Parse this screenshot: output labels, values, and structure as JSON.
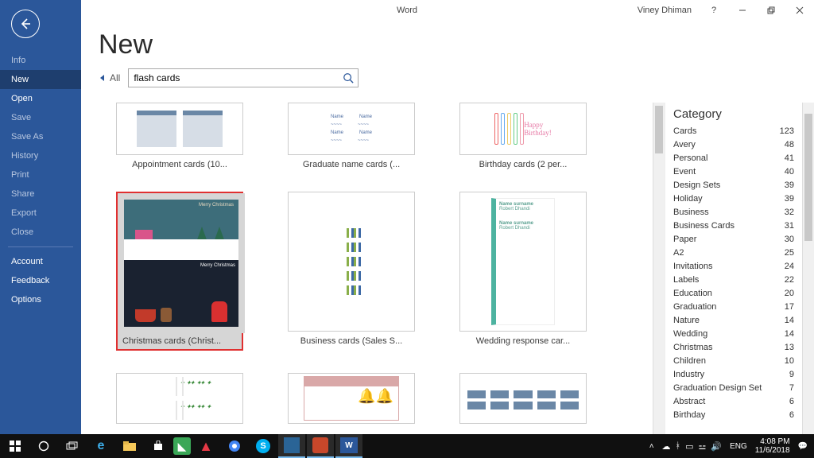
{
  "titlebar": {
    "app": "Word",
    "user": "Viney Dhiman"
  },
  "sidebar": {
    "items": [
      {
        "label": "Info",
        "enabled": false
      },
      {
        "label": "New",
        "enabled": true,
        "selected": true
      },
      {
        "label": "Open",
        "enabled": true
      },
      {
        "label": "Save",
        "enabled": false
      },
      {
        "label": "Save As",
        "enabled": false
      },
      {
        "label": "History",
        "enabled": false
      },
      {
        "label": "Print",
        "enabled": false
      },
      {
        "label": "Share",
        "enabled": false
      },
      {
        "label": "Export",
        "enabled": false
      },
      {
        "label": "Close",
        "enabled": false
      }
    ],
    "bottom": [
      {
        "label": "Account"
      },
      {
        "label": "Feedback"
      },
      {
        "label": "Options"
      }
    ]
  },
  "page": {
    "title": "New",
    "all_label": "All",
    "search_value": "flash cards"
  },
  "templates": [
    {
      "label": "Appointment cards (10...",
      "kind": "appt"
    },
    {
      "label": "Graduate name cards (...",
      "kind": "grad"
    },
    {
      "label": "Birthday cards (2 per...",
      "kind": "bday"
    },
    {
      "label": "Christmas cards (Christ...",
      "kind": "xmas",
      "highlighted": true
    },
    {
      "label": "Business cards (Sales S...",
      "kind": "biz"
    },
    {
      "label": "Wedding response car...",
      "kind": "wed"
    },
    {
      "label": "",
      "kind": "bamboo"
    },
    {
      "label": "",
      "kind": "recipe"
    },
    {
      "label": "",
      "kind": "pcards"
    }
  ],
  "category": {
    "heading": "Category",
    "items": [
      {
        "name": "Cards",
        "count": 123
      },
      {
        "name": "Avery",
        "count": 48
      },
      {
        "name": "Personal",
        "count": 41
      },
      {
        "name": "Event",
        "count": 40
      },
      {
        "name": "Design Sets",
        "count": 39
      },
      {
        "name": "Holiday",
        "count": 39
      },
      {
        "name": "Business",
        "count": 32
      },
      {
        "name": "Business Cards",
        "count": 31
      },
      {
        "name": "Paper",
        "count": 30
      },
      {
        "name": "A2",
        "count": 25
      },
      {
        "name": "Invitations",
        "count": 24
      },
      {
        "name": "Labels",
        "count": 22
      },
      {
        "name": "Education",
        "count": 20
      },
      {
        "name": "Graduation",
        "count": 17
      },
      {
        "name": "Nature",
        "count": 14
      },
      {
        "name": "Wedding",
        "count": 14
      },
      {
        "name": "Christmas",
        "count": 13
      },
      {
        "name": "Children",
        "count": 10
      },
      {
        "name": "Industry",
        "count": 9
      },
      {
        "name": "Graduation Design Set",
        "count": 7
      },
      {
        "name": "Abstract",
        "count": 6
      },
      {
        "name": "Birthday",
        "count": 6
      }
    ]
  },
  "taskbar": {
    "lang": "ENG",
    "time": "4:08 PM",
    "date": "11/6/2018"
  }
}
